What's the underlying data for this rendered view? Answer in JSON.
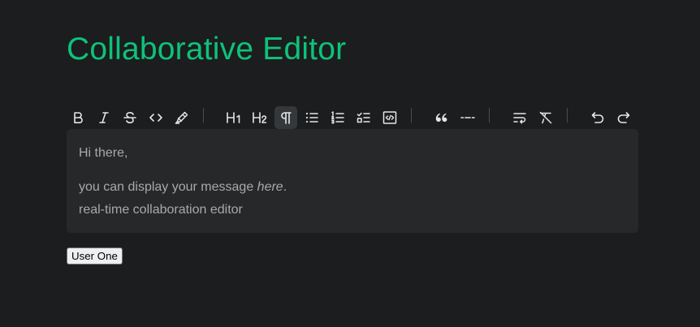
{
  "page": {
    "title": "Collaborative Editor"
  },
  "toolbar": {
    "buttons": [
      {
        "name": "bold",
        "icon": "bold-icon",
        "label": "B"
      },
      {
        "name": "italic",
        "icon": "italic-icon"
      },
      {
        "name": "strikethrough",
        "icon": "strikethrough-icon"
      },
      {
        "name": "code",
        "icon": "code-icon"
      },
      {
        "name": "highlight",
        "icon": "mark-pen-icon"
      },
      {
        "name": "heading-1",
        "icon": "heading-1-icon",
        "label": "H1"
      },
      {
        "name": "heading-2",
        "icon": "heading-2-icon",
        "label": "H2"
      },
      {
        "name": "paragraph",
        "icon": "paragraph-icon",
        "active": true
      },
      {
        "name": "bullet-list",
        "icon": "bullet-list-icon"
      },
      {
        "name": "ordered-list",
        "icon": "ordered-list-icon"
      },
      {
        "name": "task-list",
        "icon": "task-list-icon"
      },
      {
        "name": "code-block",
        "icon": "code-block-icon"
      },
      {
        "name": "blockquote",
        "icon": "double-quotes-icon"
      },
      {
        "name": "horizontal-rule",
        "icon": "separator-icon"
      },
      {
        "name": "hard-break",
        "icon": "text-wrap-icon"
      },
      {
        "name": "clear-format",
        "icon": "format-clear-icon"
      },
      {
        "name": "undo",
        "icon": "undo-icon"
      },
      {
        "name": "redo",
        "icon": "redo-icon"
      }
    ]
  },
  "editor": {
    "line1": "Hi there,",
    "line2_before": "you can display your message ",
    "line2_em": "here",
    "line2_after": ".",
    "line3": "real-time collaboration editor"
  },
  "user_button": {
    "label": "User One"
  },
  "colors": {
    "background": "#1b1d1e",
    "accent": "#0ec27a",
    "editor_bg": "#262829",
    "text": "#a7a9aa",
    "icon": "#e6e6e6",
    "active_button_bg": "#35383a"
  }
}
